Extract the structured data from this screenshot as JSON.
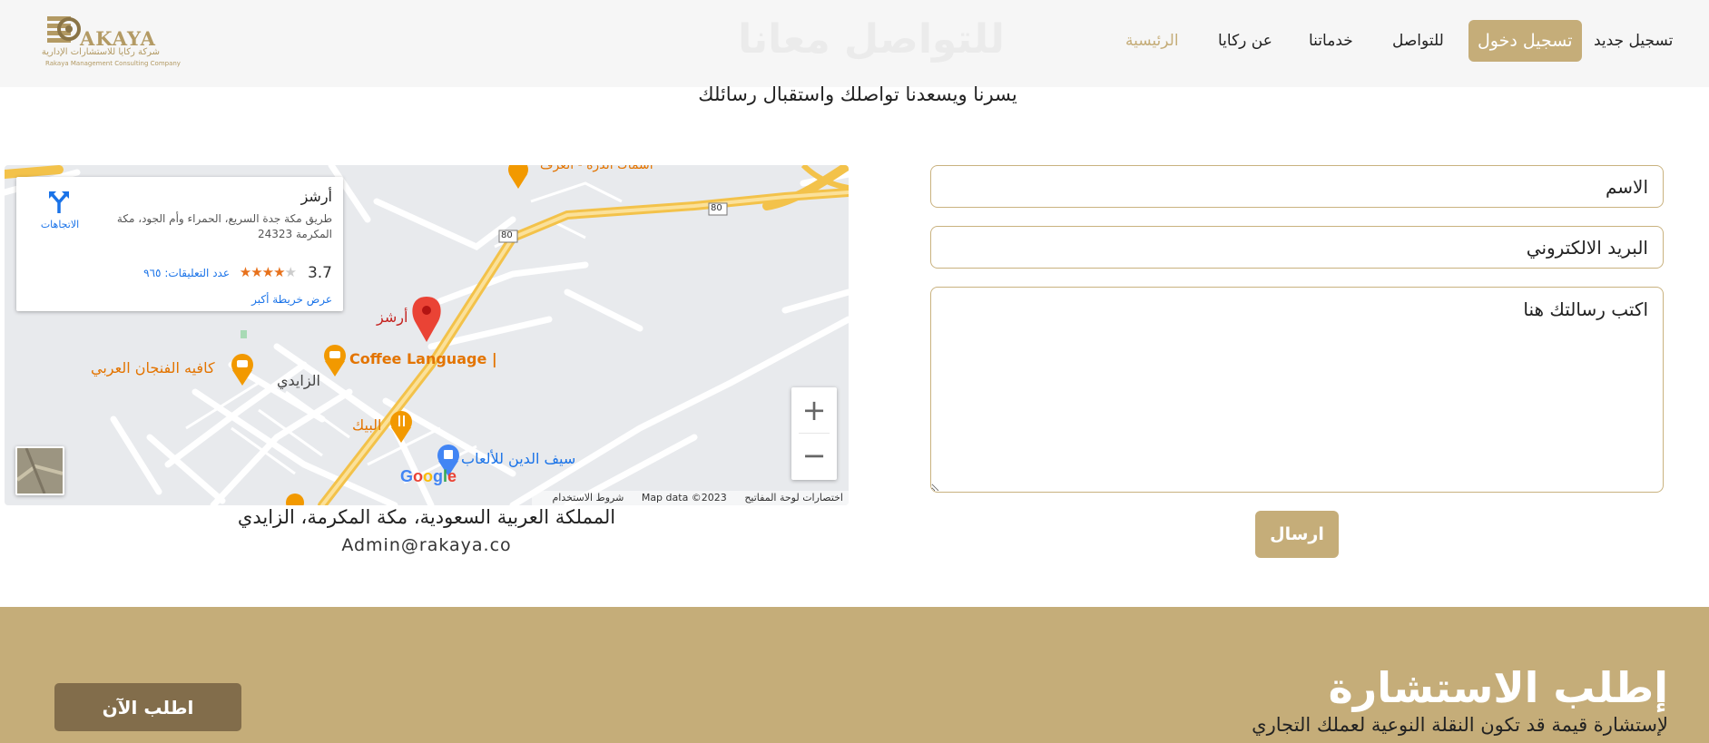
{
  "logo": {
    "brand": "AKAYA",
    "arabic_name": "شركة ركايا للاستشارات الإدارية",
    "english_name": "Rakaya Management Consulting Company"
  },
  "header": {
    "ghost_title": "للتواصل معانا",
    "nav": {
      "home": "الرئيسية",
      "about": "عن ركايا",
      "services": "خدماتنا",
      "contact": "للتواصل",
      "login": "تسجيل دخول",
      "register": "تسجيل جديد"
    }
  },
  "subtitle": "يسرنا ويسعدنا تواصلك واستقبال رسائلك",
  "map": {
    "info_card": {
      "place_name": "أرشز",
      "address": "طريق مكة جدة السريع، الحمراء وأم الجود، مكة المكرمة 24323",
      "rating": "3.7",
      "reviews": "عدد التعليقات: ٩٦٥",
      "larger_map": "عرض خريطة أكبر",
      "directions": "الاتجاهات"
    },
    "labels": {
      "pin": "أرشز",
      "coffee_language": "Coffee Language |",
      "cafe": "كافيه الفنجان العربي",
      "district": "الزايدي",
      "baik": "البيك",
      "toy_store": "سيف الدين للألعاب",
      "top_place": "أسماك الدرة - العرف",
      "road_80a": "80",
      "road_80b": "80"
    },
    "google": "Google",
    "attribution": {
      "shortcuts": "اختصارات لوحة المفاتيح",
      "data": "Map data ©2023",
      "terms": "شروط الاستخدام"
    },
    "zoom_in": "+",
    "zoom_out": "−"
  },
  "contact_info": {
    "address": "المملكة العربية السعودية، مكة المكرمة، الزايدي",
    "email": "Admin@rakaya.co"
  },
  "form": {
    "name_placeholder": "الاسم",
    "email_placeholder": "البريد الالكتروني",
    "message_placeholder": "اكتب رسالتك هنا",
    "submit": "ارسال"
  },
  "cta": {
    "title": "إطلب الاستشارة",
    "subtitle": "لإستشارة قيمة قد تكون النقلة النوعية لعملك التجاري",
    "button": "اطلب الآن"
  },
  "colors": {
    "accent": "#c5ad79",
    "cta_button": "#826d4b",
    "header_bg": "#f6f6f6",
    "map_pin": "#ea4335",
    "poi_orange": "#f29900"
  }
}
